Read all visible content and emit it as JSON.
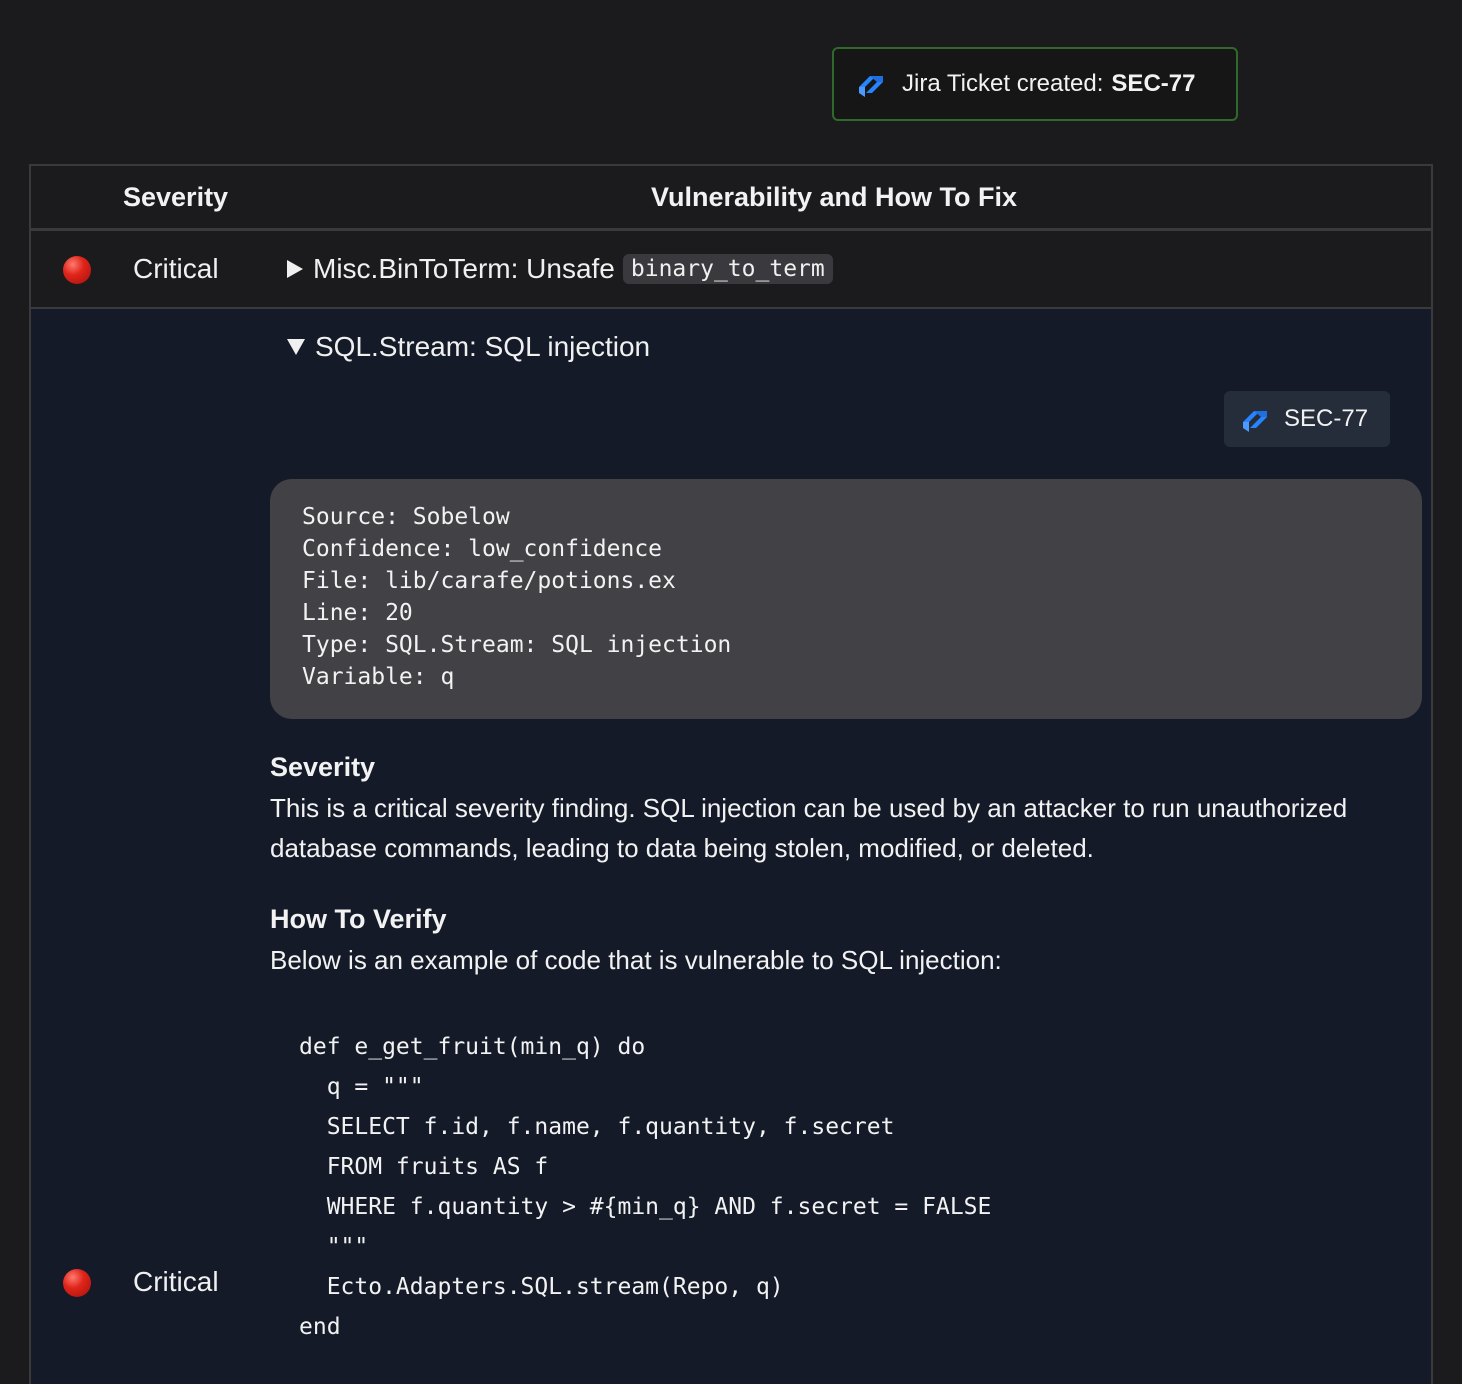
{
  "toast": {
    "prefix": "Jira Ticket created:",
    "ticket": "SEC-77"
  },
  "table": {
    "headers": {
      "severity": "Severity",
      "vulnerability": "Vulnerability and How To Fix"
    },
    "rows": [
      {
        "severity": "Critical",
        "summary_text": "Misc.BinToTerm: Unsafe",
        "summary_code": "binary_to_term",
        "expanded": false
      },
      {
        "severity": "Critical",
        "summary_text": "SQL.Stream: SQL injection",
        "expanded": true,
        "jira_badge": "SEC-77",
        "info": [
          "Source: Sobelow",
          "Confidence: low_confidence",
          "File: lib/carafe/potions.ex",
          "Line: 20",
          "Type: SQL.Stream: SQL injection",
          "Variable: q"
        ],
        "severity_title": "Severity",
        "severity_body": "This is a critical severity finding. SQL injection can be used by an attacker to run unauthorized database commands, leading to data being stolen, modified, or deleted.",
        "verify_title": "How To Verify",
        "verify_body": "Below is an example of code that is vulnerable to SQL injection:",
        "code": [
          "def e_get_fruit(min_q) do",
          "  q = \"\"\"",
          "  SELECT f.id, f.name, f.quantity, f.secret",
          "  FROM fruits AS f",
          "  WHERE f.quantity > #{min_q} AND f.secret = FALSE",
          "  \"\"\"",
          "  Ecto.Adapters.SQL.stream(Repo, q)",
          "end"
        ]
      }
    ]
  },
  "colors": {
    "page_bg": "#1b1b1d",
    "expanded_row_bg": "#141a28",
    "toast_border": "#2f6a2b",
    "severity_dot": "#e0251b",
    "jira_blue": "#2684ff"
  },
  "icons": {
    "jira": "jira-icon",
    "severity": "red-circle-icon",
    "collapsed": "triangle-right-icon",
    "expanded": "triangle-down-icon"
  }
}
